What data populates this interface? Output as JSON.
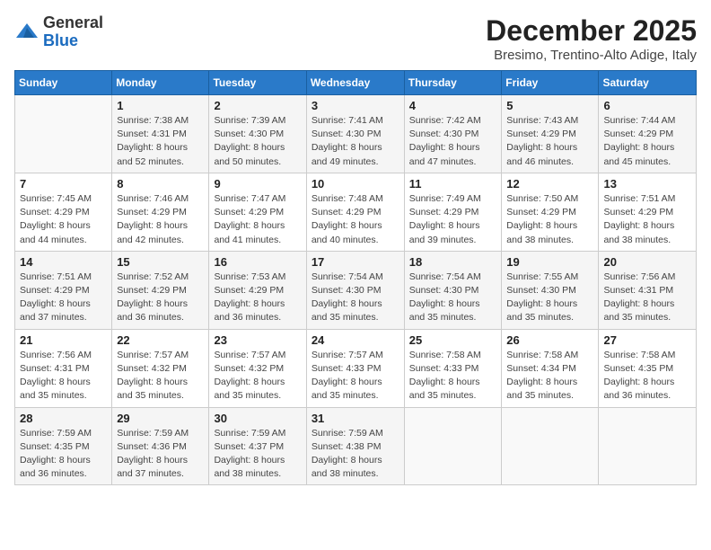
{
  "logo": {
    "general": "General",
    "blue": "Blue"
  },
  "header": {
    "month": "December 2025",
    "location": "Bresimo, Trentino-Alto Adige, Italy"
  },
  "days_of_week": [
    "Sunday",
    "Monday",
    "Tuesday",
    "Wednesday",
    "Thursday",
    "Friday",
    "Saturday"
  ],
  "weeks": [
    [
      {
        "day": "",
        "info": ""
      },
      {
        "day": "1",
        "info": "Sunrise: 7:38 AM\nSunset: 4:31 PM\nDaylight: 8 hours\nand 52 minutes."
      },
      {
        "day": "2",
        "info": "Sunrise: 7:39 AM\nSunset: 4:30 PM\nDaylight: 8 hours\nand 50 minutes."
      },
      {
        "day": "3",
        "info": "Sunrise: 7:41 AM\nSunset: 4:30 PM\nDaylight: 8 hours\nand 49 minutes."
      },
      {
        "day": "4",
        "info": "Sunrise: 7:42 AM\nSunset: 4:30 PM\nDaylight: 8 hours\nand 47 minutes."
      },
      {
        "day": "5",
        "info": "Sunrise: 7:43 AM\nSunset: 4:29 PM\nDaylight: 8 hours\nand 46 minutes."
      },
      {
        "day": "6",
        "info": "Sunrise: 7:44 AM\nSunset: 4:29 PM\nDaylight: 8 hours\nand 45 minutes."
      }
    ],
    [
      {
        "day": "7",
        "info": "Sunrise: 7:45 AM\nSunset: 4:29 PM\nDaylight: 8 hours\nand 44 minutes."
      },
      {
        "day": "8",
        "info": "Sunrise: 7:46 AM\nSunset: 4:29 PM\nDaylight: 8 hours\nand 42 minutes."
      },
      {
        "day": "9",
        "info": "Sunrise: 7:47 AM\nSunset: 4:29 PM\nDaylight: 8 hours\nand 41 minutes."
      },
      {
        "day": "10",
        "info": "Sunrise: 7:48 AM\nSunset: 4:29 PM\nDaylight: 8 hours\nand 40 minutes."
      },
      {
        "day": "11",
        "info": "Sunrise: 7:49 AM\nSunset: 4:29 PM\nDaylight: 8 hours\nand 39 minutes."
      },
      {
        "day": "12",
        "info": "Sunrise: 7:50 AM\nSunset: 4:29 PM\nDaylight: 8 hours\nand 38 minutes."
      },
      {
        "day": "13",
        "info": "Sunrise: 7:51 AM\nSunset: 4:29 PM\nDaylight: 8 hours\nand 38 minutes."
      }
    ],
    [
      {
        "day": "14",
        "info": "Sunrise: 7:51 AM\nSunset: 4:29 PM\nDaylight: 8 hours\nand 37 minutes."
      },
      {
        "day": "15",
        "info": "Sunrise: 7:52 AM\nSunset: 4:29 PM\nDaylight: 8 hours\nand 36 minutes."
      },
      {
        "day": "16",
        "info": "Sunrise: 7:53 AM\nSunset: 4:29 PM\nDaylight: 8 hours\nand 36 minutes."
      },
      {
        "day": "17",
        "info": "Sunrise: 7:54 AM\nSunset: 4:30 PM\nDaylight: 8 hours\nand 35 minutes."
      },
      {
        "day": "18",
        "info": "Sunrise: 7:54 AM\nSunset: 4:30 PM\nDaylight: 8 hours\nand 35 minutes."
      },
      {
        "day": "19",
        "info": "Sunrise: 7:55 AM\nSunset: 4:30 PM\nDaylight: 8 hours\nand 35 minutes."
      },
      {
        "day": "20",
        "info": "Sunrise: 7:56 AM\nSunset: 4:31 PM\nDaylight: 8 hours\nand 35 minutes."
      }
    ],
    [
      {
        "day": "21",
        "info": "Sunrise: 7:56 AM\nSunset: 4:31 PM\nDaylight: 8 hours\nand 35 minutes."
      },
      {
        "day": "22",
        "info": "Sunrise: 7:57 AM\nSunset: 4:32 PM\nDaylight: 8 hours\nand 35 minutes."
      },
      {
        "day": "23",
        "info": "Sunrise: 7:57 AM\nSunset: 4:32 PM\nDaylight: 8 hours\nand 35 minutes."
      },
      {
        "day": "24",
        "info": "Sunrise: 7:57 AM\nSunset: 4:33 PM\nDaylight: 8 hours\nand 35 minutes."
      },
      {
        "day": "25",
        "info": "Sunrise: 7:58 AM\nSunset: 4:33 PM\nDaylight: 8 hours\nand 35 minutes."
      },
      {
        "day": "26",
        "info": "Sunrise: 7:58 AM\nSunset: 4:34 PM\nDaylight: 8 hours\nand 35 minutes."
      },
      {
        "day": "27",
        "info": "Sunrise: 7:58 AM\nSunset: 4:35 PM\nDaylight: 8 hours\nand 36 minutes."
      }
    ],
    [
      {
        "day": "28",
        "info": "Sunrise: 7:59 AM\nSunset: 4:35 PM\nDaylight: 8 hours\nand 36 minutes."
      },
      {
        "day": "29",
        "info": "Sunrise: 7:59 AM\nSunset: 4:36 PM\nDaylight: 8 hours\nand 37 minutes."
      },
      {
        "day": "30",
        "info": "Sunrise: 7:59 AM\nSunset: 4:37 PM\nDaylight: 8 hours\nand 38 minutes."
      },
      {
        "day": "31",
        "info": "Sunrise: 7:59 AM\nSunset: 4:38 PM\nDaylight: 8 hours\nand 38 minutes."
      },
      {
        "day": "",
        "info": ""
      },
      {
        "day": "",
        "info": ""
      },
      {
        "day": "",
        "info": ""
      }
    ]
  ]
}
